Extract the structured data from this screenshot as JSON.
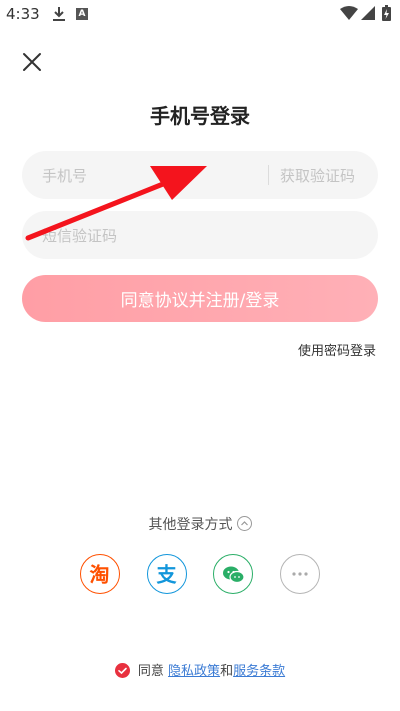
{
  "status_bar": {
    "time": "4:33",
    "a_badge": "A"
  },
  "page": {
    "title": "手机号登录"
  },
  "phone_input": {
    "placeholder": "手机号",
    "value": ""
  },
  "get_code": {
    "label": "获取验证码"
  },
  "sms_input": {
    "placeholder": "短信验证码",
    "value": ""
  },
  "submit": {
    "label": "同意协议并注册/登录"
  },
  "password_login": {
    "label": "使用密码登录"
  },
  "other_methods": {
    "label": "其他登录方式"
  },
  "social": {
    "taobao_label": "淘",
    "alipay_label": "支"
  },
  "agreement": {
    "prefix": "同意",
    "privacy_link": "隐私政策",
    "and": "和",
    "terms_link": "服务条款"
  },
  "colors": {
    "accent_red": "#e8313f",
    "button_gradient_start": "#ff9ea5",
    "button_gradient_end": "#ffb0b7",
    "link_blue": "#3b7bd4",
    "taobao_orange": "#ff5000",
    "alipay_blue": "#1296db",
    "wechat_green": "#2aae67"
  }
}
